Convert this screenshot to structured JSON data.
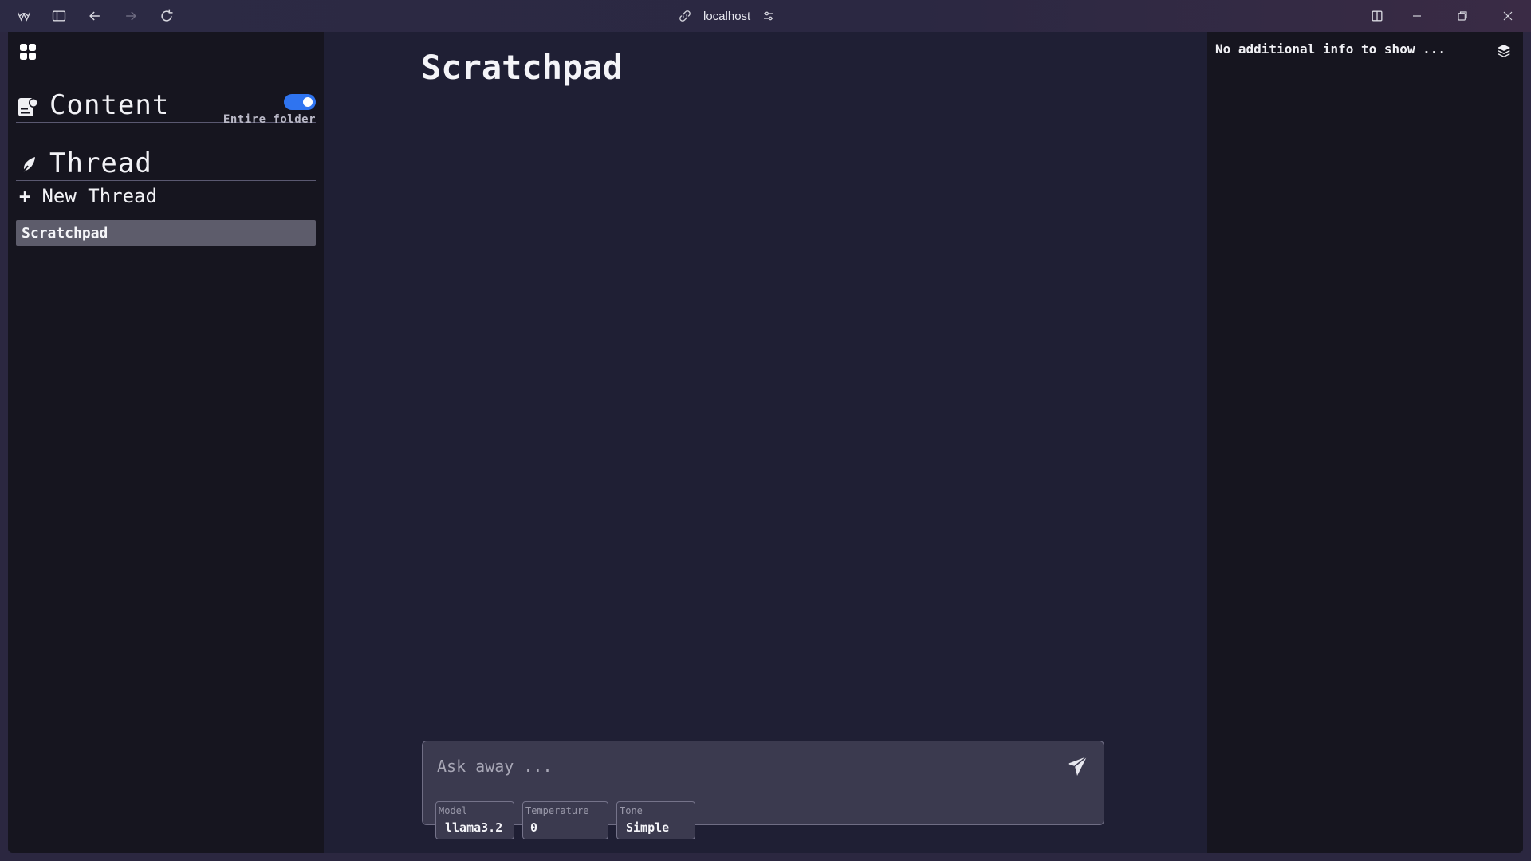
{
  "browser": {
    "url": "localhost",
    "icons": [
      "app-logo-icon",
      "sidebar-toggle-icon",
      "back-icon",
      "forward-icon",
      "reload-icon",
      "link-icon",
      "site-settings-icon",
      "split-view-icon",
      "minimize-icon",
      "restore-icon",
      "close-icon"
    ]
  },
  "sidebar": {
    "content_section": {
      "title": "Content",
      "toggle_label": "Entire folder",
      "toggle_on": true
    },
    "thread_section": {
      "title": "Thread"
    },
    "new_thread_label": "New Thread",
    "threads": [
      {
        "label": "Scratchpad",
        "selected": true
      }
    ]
  },
  "main": {
    "title": "Scratchpad",
    "composer": {
      "placeholder": "Ask away ...",
      "value": ""
    },
    "options": [
      {
        "label": "Model",
        "value": "llama3.2"
      },
      {
        "label": "Temperature",
        "value": "0"
      },
      {
        "label": "Tone",
        "value": "Simple"
      }
    ]
  },
  "right_panel": {
    "info": "No additional info to show ..."
  },
  "colors": {
    "accent_toggle": "#2f74f0",
    "sidebar_bg": "#16151f",
    "main_bg": "#1f1f34",
    "selected_item_bg": "#5d5c6b"
  }
}
